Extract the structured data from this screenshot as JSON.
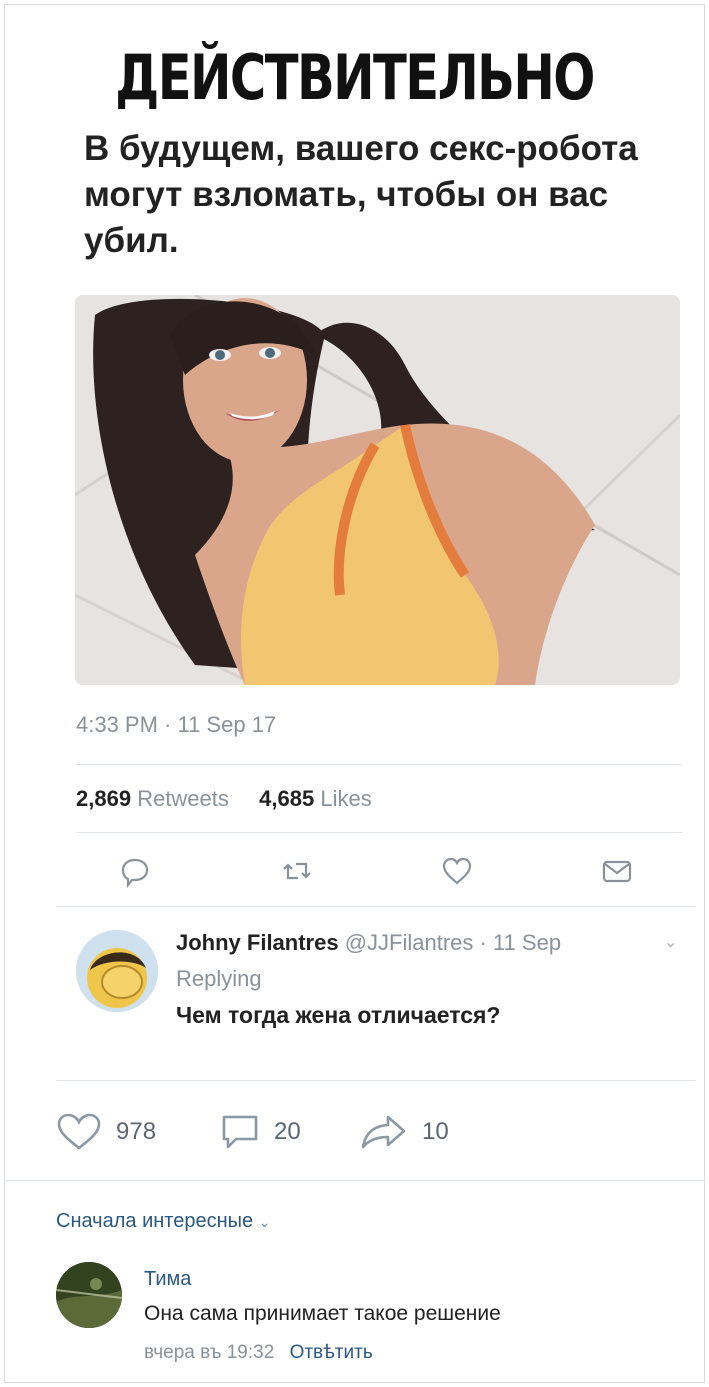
{
  "post": {
    "headline": "ДЕЙСТВИТЕЛЬНО",
    "text": "В будущем, вашего секс-робота могут взломать, чтобы он вас убил.",
    "timestamp": "4:33 PM · 11 Sep 17",
    "retweets_count": "2,869",
    "retweets_label": "Retweets",
    "likes_count": "4,685",
    "likes_label": "Likes"
  },
  "reply": {
    "name": "Johny Filantres",
    "handle": "@JJFilantres",
    "date": "· 11 Sep",
    "replying": "Replying",
    "text": "Чем тогда жена отличается?"
  },
  "vk_actions": {
    "likes": "978",
    "comments": "20",
    "shares": "10"
  },
  "comments": {
    "sort_label": "Сначала интересные",
    "items": [
      {
        "author": "Тима",
        "text": "Она сама принимает такое решение",
        "time": "вчера въ 19:32",
        "reply_label": "Отвѣтить"
      }
    ]
  },
  "icons": {
    "tweet_actions": [
      "reply-icon",
      "retweet-icon",
      "like-icon",
      "message-icon"
    ],
    "vk_actions": [
      "heart-icon",
      "comment-icon",
      "share-icon"
    ]
  },
  "colors": {
    "link": "#2a5885",
    "muted": "#8a9299",
    "text": "#222222"
  }
}
